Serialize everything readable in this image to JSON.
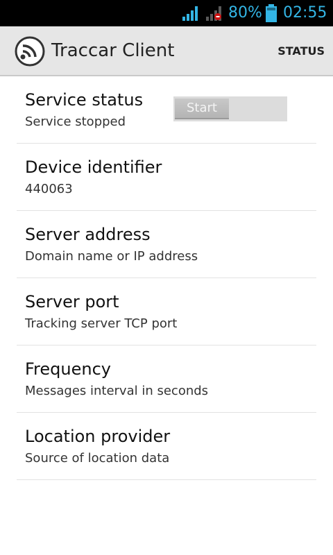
{
  "status_bar": {
    "battery_percent": "80%",
    "time": "02:55",
    "accent_color": "#33b5e5",
    "icons": [
      "signal-icon",
      "signal-no-sim-icon",
      "battery-icon"
    ]
  },
  "action_bar": {
    "title": "Traccar Client",
    "action_label": "STATUS",
    "icon": "traccar-logo-icon"
  },
  "preferences": [
    {
      "title": "Service status",
      "summary": "Service stopped",
      "toggle_label": "Start",
      "toggle_on": false
    },
    {
      "title": "Device identifier",
      "summary": "440063"
    },
    {
      "title": "Server address",
      "summary": "Domain name or IP address"
    },
    {
      "title": "Server port",
      "summary": "Tracking server TCP port"
    },
    {
      "title": "Frequency",
      "summary": "Messages interval in seconds"
    },
    {
      "title": "Location provider",
      "summary": "Source of location data"
    }
  ]
}
